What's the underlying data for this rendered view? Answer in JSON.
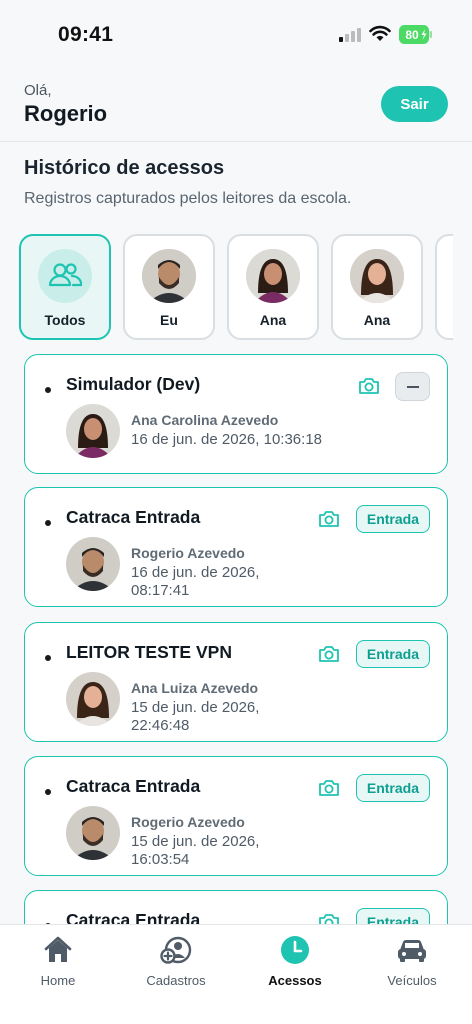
{
  "status_bar": {
    "time": "09:41",
    "battery": "80"
  },
  "header": {
    "greeting": "Olá,",
    "username": "Rogerio",
    "logout_label": "Sair"
  },
  "section": {
    "title": "Histórico de acessos",
    "subtitle": "Registros capturados pelos leitores da escola."
  },
  "filters": [
    {
      "label": "Todos",
      "active": true
    },
    {
      "label": "Eu",
      "active": false
    },
    {
      "label": "Ana",
      "active": false
    },
    {
      "label": "Ana",
      "active": false
    }
  ],
  "accesses": [
    {
      "reader": "Simulador (Dev)",
      "person": "Ana Carolina Azevedo",
      "date": "16 de jun. de 2026, 10:36:18",
      "direction": ""
    },
    {
      "reader": "Catraca Entrada",
      "person": "Rogerio Azevedo",
      "date": "16 de jun. de 2026, 08:17:41",
      "direction": "Entrada"
    },
    {
      "reader": "LEITOR TESTE VPN",
      "person": "Ana Luiza Azevedo",
      "date": "15 de jun. de 2026, 22:46:48",
      "direction": "Entrada"
    },
    {
      "reader": "Catraca Entrada",
      "person": "Rogerio Azevedo",
      "date": "15 de jun. de 2026, 16:03:54",
      "direction": "Entrada"
    },
    {
      "reader": "Catraca Entrada",
      "person": "",
      "date": "",
      "direction": "Entrada"
    }
  ],
  "tabbar": [
    {
      "label": "Home",
      "icon": "home-icon"
    },
    {
      "label": "Cadastros",
      "icon": "user-add-icon"
    },
    {
      "label": "Acessos",
      "icon": "clock-icon",
      "active": true
    },
    {
      "label": "Veículos",
      "icon": "car-icon"
    }
  ],
  "colors": {
    "accent": "#1ec4b1",
    "accent_light": "#e8f7f5",
    "text": "#16202a"
  }
}
